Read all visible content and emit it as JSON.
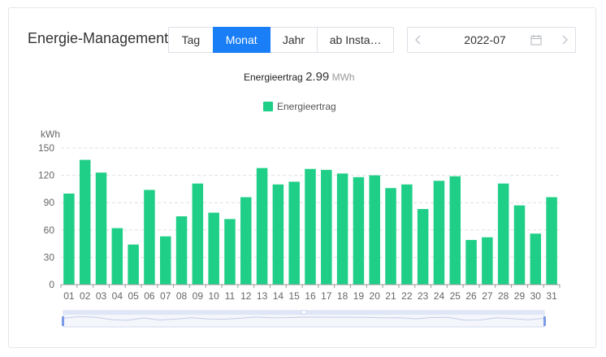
{
  "header": {
    "title": "Energie-Management",
    "tabs": [
      {
        "label": "Tag",
        "active": false
      },
      {
        "label": "Monat",
        "active": true
      },
      {
        "label": "Jahr",
        "active": false
      },
      {
        "label": "ab Insta…",
        "active": false
      }
    ],
    "datepicker": {
      "value": "2022-07",
      "prev_icon": "chevron-left-icon",
      "next_icon": "chevron-right-icon",
      "calendar_icon": "calendar-icon"
    }
  },
  "summary": {
    "label": "Energieertrag",
    "value": "2.99",
    "unit": "MWh"
  },
  "colors": {
    "accent": "#1a7ef7",
    "bar": "#1fcf87",
    "grid": "#e0e0e0",
    "slider_fill": "#dfe6f7",
    "slider_handle": "#7c9be6"
  },
  "chart_data": {
    "type": "bar",
    "ylabel": "kWh",
    "ylim": [
      0,
      150
    ],
    "yticks": [
      0,
      30,
      60,
      90,
      120,
      150
    ],
    "categories": [
      "01",
      "02",
      "03",
      "04",
      "05",
      "06",
      "07",
      "08",
      "09",
      "10",
      "11",
      "12",
      "13",
      "14",
      "15",
      "16",
      "17",
      "18",
      "19",
      "20",
      "21",
      "22",
      "23",
      "24",
      "25",
      "26",
      "27",
      "28",
      "29",
      "30",
      "31"
    ],
    "series": [
      {
        "name": "Energieertrag",
        "values": [
          100,
          137,
          123,
          62,
          44,
          104,
          53,
          75,
          111,
          79,
          72,
          96,
          128,
          110,
          113,
          127,
          126,
          122,
          118,
          120,
          106,
          110,
          83,
          114,
          119,
          49,
          52,
          111,
          87,
          56,
          96
        ]
      }
    ],
    "grid": true,
    "legend": "top-center",
    "zoom_slider": true
  }
}
